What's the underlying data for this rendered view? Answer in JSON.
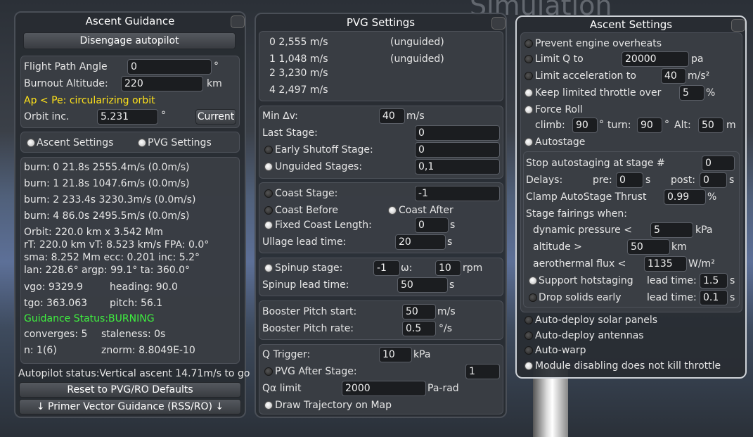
{
  "background_text": "Simulation",
  "ascent_guidance": {
    "title": "Ascent Guidance",
    "disengage_label": "Disengage autopilot",
    "fpa_label": "Flight Path Angle",
    "fpa_value": "0",
    "fpa_unit": "°",
    "burnout_label": "Burnout Altitude:",
    "burnout_value": "220",
    "burnout_unit": "km",
    "ap_pe_msg": "Ap < Pe: circularizing orbit",
    "orbit_inc_label": "Orbit inc.",
    "orbit_inc_value": "5.231",
    "orbit_inc_unit": "°",
    "current_button": "Current",
    "tab_ascent": "Ascent Settings",
    "tab_pvg": "PVG Settings",
    "burns": [
      "burn: 0 21.8s 2555.4m/s (0.0m/s)",
      "burn: 1 21.8s 1047.6m/s (0.0m/s)",
      "burn: 2 233.4s 3230.3m/s (0.0m/s)",
      "burn: 4 86.0s 2495.5m/s (0.0m/s)"
    ],
    "orbit_line": "Orbit: 220.0 km x 3.542 Mm",
    "rt_line": "rT: 220.0 km vT: 8.523 km/s FPA: 0.0°",
    "sma_line": "sma: 8.252 Mm ecc: 0.201 inc: 5.2°",
    "lan_line": "lan: 228.6° argp: 99.1° ta: 360.0°",
    "vgo": "vgo: 9329.9",
    "heading": "heading: 90.0",
    "tgo": "tgo: 363.063",
    "pitch": "pitch: 56.1",
    "guidance_status": "Guidance Status:BURNING",
    "converges": "converges: 5",
    "staleness": "staleness: 0s",
    "n": "n: 1(6)",
    "znorm": "znorm: 8.8049E-10",
    "autopilot_status": "Autopilot status:Vertical ascent 14.71m/s to go",
    "reset_button": "Reset to PVG/RO Defaults",
    "primer_button": "↓ Primer Vector Guidance (RSS/RO) ↓"
  },
  "pvg_settings": {
    "title": "PVG Settings",
    "stages": [
      {
        "label": "0 2,555 m/s",
        "note": "(unguided)"
      },
      {
        "label": "1 1,048 m/s",
        "note": "(unguided)"
      },
      {
        "label": "2 3,230 m/s",
        "note": ""
      },
      {
        "label": "4 2,497 m/s",
        "note": ""
      }
    ],
    "min_dv_label": "Min ∆v:",
    "min_dv_value": "40",
    "min_dv_unit": "m/s",
    "last_stage_label": "Last Stage:",
    "last_stage_value": "0",
    "early_shutoff_label": "Early Shutoff Stage:",
    "early_shutoff_value": "0",
    "unguided_label": "Unguided Stages:",
    "unguided_value": "0,1",
    "coast_stage_label": "Coast Stage:",
    "coast_stage_value": "-1",
    "coast_before_label": "Coast Before",
    "coast_after_label": "Coast After",
    "fixed_coast_label": "Fixed Coast Length:",
    "fixed_coast_value": "0",
    "fixed_coast_unit": "s",
    "ullage_label": "Ullage lead time:",
    "ullage_value": "20",
    "ullage_unit": "s",
    "spinup_label": "Spinup stage:",
    "spinup_value": "-1",
    "omega_label": "ω:",
    "omega_value": "10",
    "omega_unit": "rpm",
    "spinup_lead_label": "Spinup lead time:",
    "spinup_lead_value": "50",
    "spinup_lead_unit": "s",
    "booster_start_label": "Booster Pitch start:",
    "booster_start_value": "50",
    "booster_start_unit": "m/s",
    "booster_rate_label": "Booster Pitch rate:",
    "booster_rate_value": "0.5",
    "booster_rate_unit": "°/s",
    "q_trigger_label": "Q Trigger:",
    "q_trigger_value": "10",
    "q_trigger_unit": "kPa",
    "pvg_after_label": "PVG After Stage:",
    "pvg_after_value": "1",
    "qa_limit_label": "Qα limit",
    "qa_limit_value": "2000",
    "qa_limit_unit": "Pa-rad",
    "draw_traj_label": "Draw Trajectory on Map"
  },
  "ascent_settings": {
    "title": "Ascent Settings",
    "prevent_overheats": "Prevent engine overheats",
    "limit_q_label": "Limit Q to",
    "limit_q_value": "20000",
    "limit_q_unit": "pa",
    "limit_accel_label": "Limit acceleration to",
    "limit_accel_value": "40",
    "limit_accel_unit": "m/s²",
    "keep_throttle_label": "Keep limited throttle over",
    "keep_throttle_value": "5",
    "keep_throttle_unit": "%",
    "force_roll_label": "Force Roll",
    "climb_label": "climb:",
    "climb_value": "90",
    "climb_unit": "°",
    "turn_label": "turn:",
    "turn_value": "90",
    "turn_unit": "°",
    "alt_label": "Alt:",
    "alt_value": "50",
    "alt_unit": "m",
    "autostage_label": "Autostage",
    "stop_autostage_label": "Stop autostaging at stage #",
    "stop_autostage_value": "0",
    "delays_label": "Delays:",
    "pre_label": "pre:",
    "pre_value": "0",
    "pre_unit": "s",
    "post_label": "post:",
    "post_value": "0",
    "post_unit": "s",
    "clamp_label": "Clamp AutoStage Thrust",
    "clamp_value": "0.99",
    "clamp_unit": "%",
    "fairings_label": "Stage fairings when:",
    "dyn_pressure_label": "dynamic pressure <",
    "dyn_pressure_value": "5",
    "dyn_pressure_unit": "kPa",
    "altitude_label": "altitude >",
    "altitude_value": "50",
    "altitude_unit": "km",
    "aero_flux_label": "aerothermal flux <",
    "aero_flux_value": "1135",
    "aero_flux_unit": "W/m²",
    "support_hot_label": "Support hotstaging",
    "hot_lead_label": "lead time:",
    "hot_lead_value": "1.5",
    "hot_lead_unit": "s",
    "drop_solids_label": "Drop solids early",
    "solids_lead_label": "lead time:",
    "solids_lead_value": "0.1",
    "solids_lead_unit": "s",
    "auto_solar": "Auto-deploy solar panels",
    "auto_antennas": "Auto-deploy antennas",
    "auto_warp": "Auto-warp",
    "module_disabling": "Module disabling does not kill throttle"
  }
}
